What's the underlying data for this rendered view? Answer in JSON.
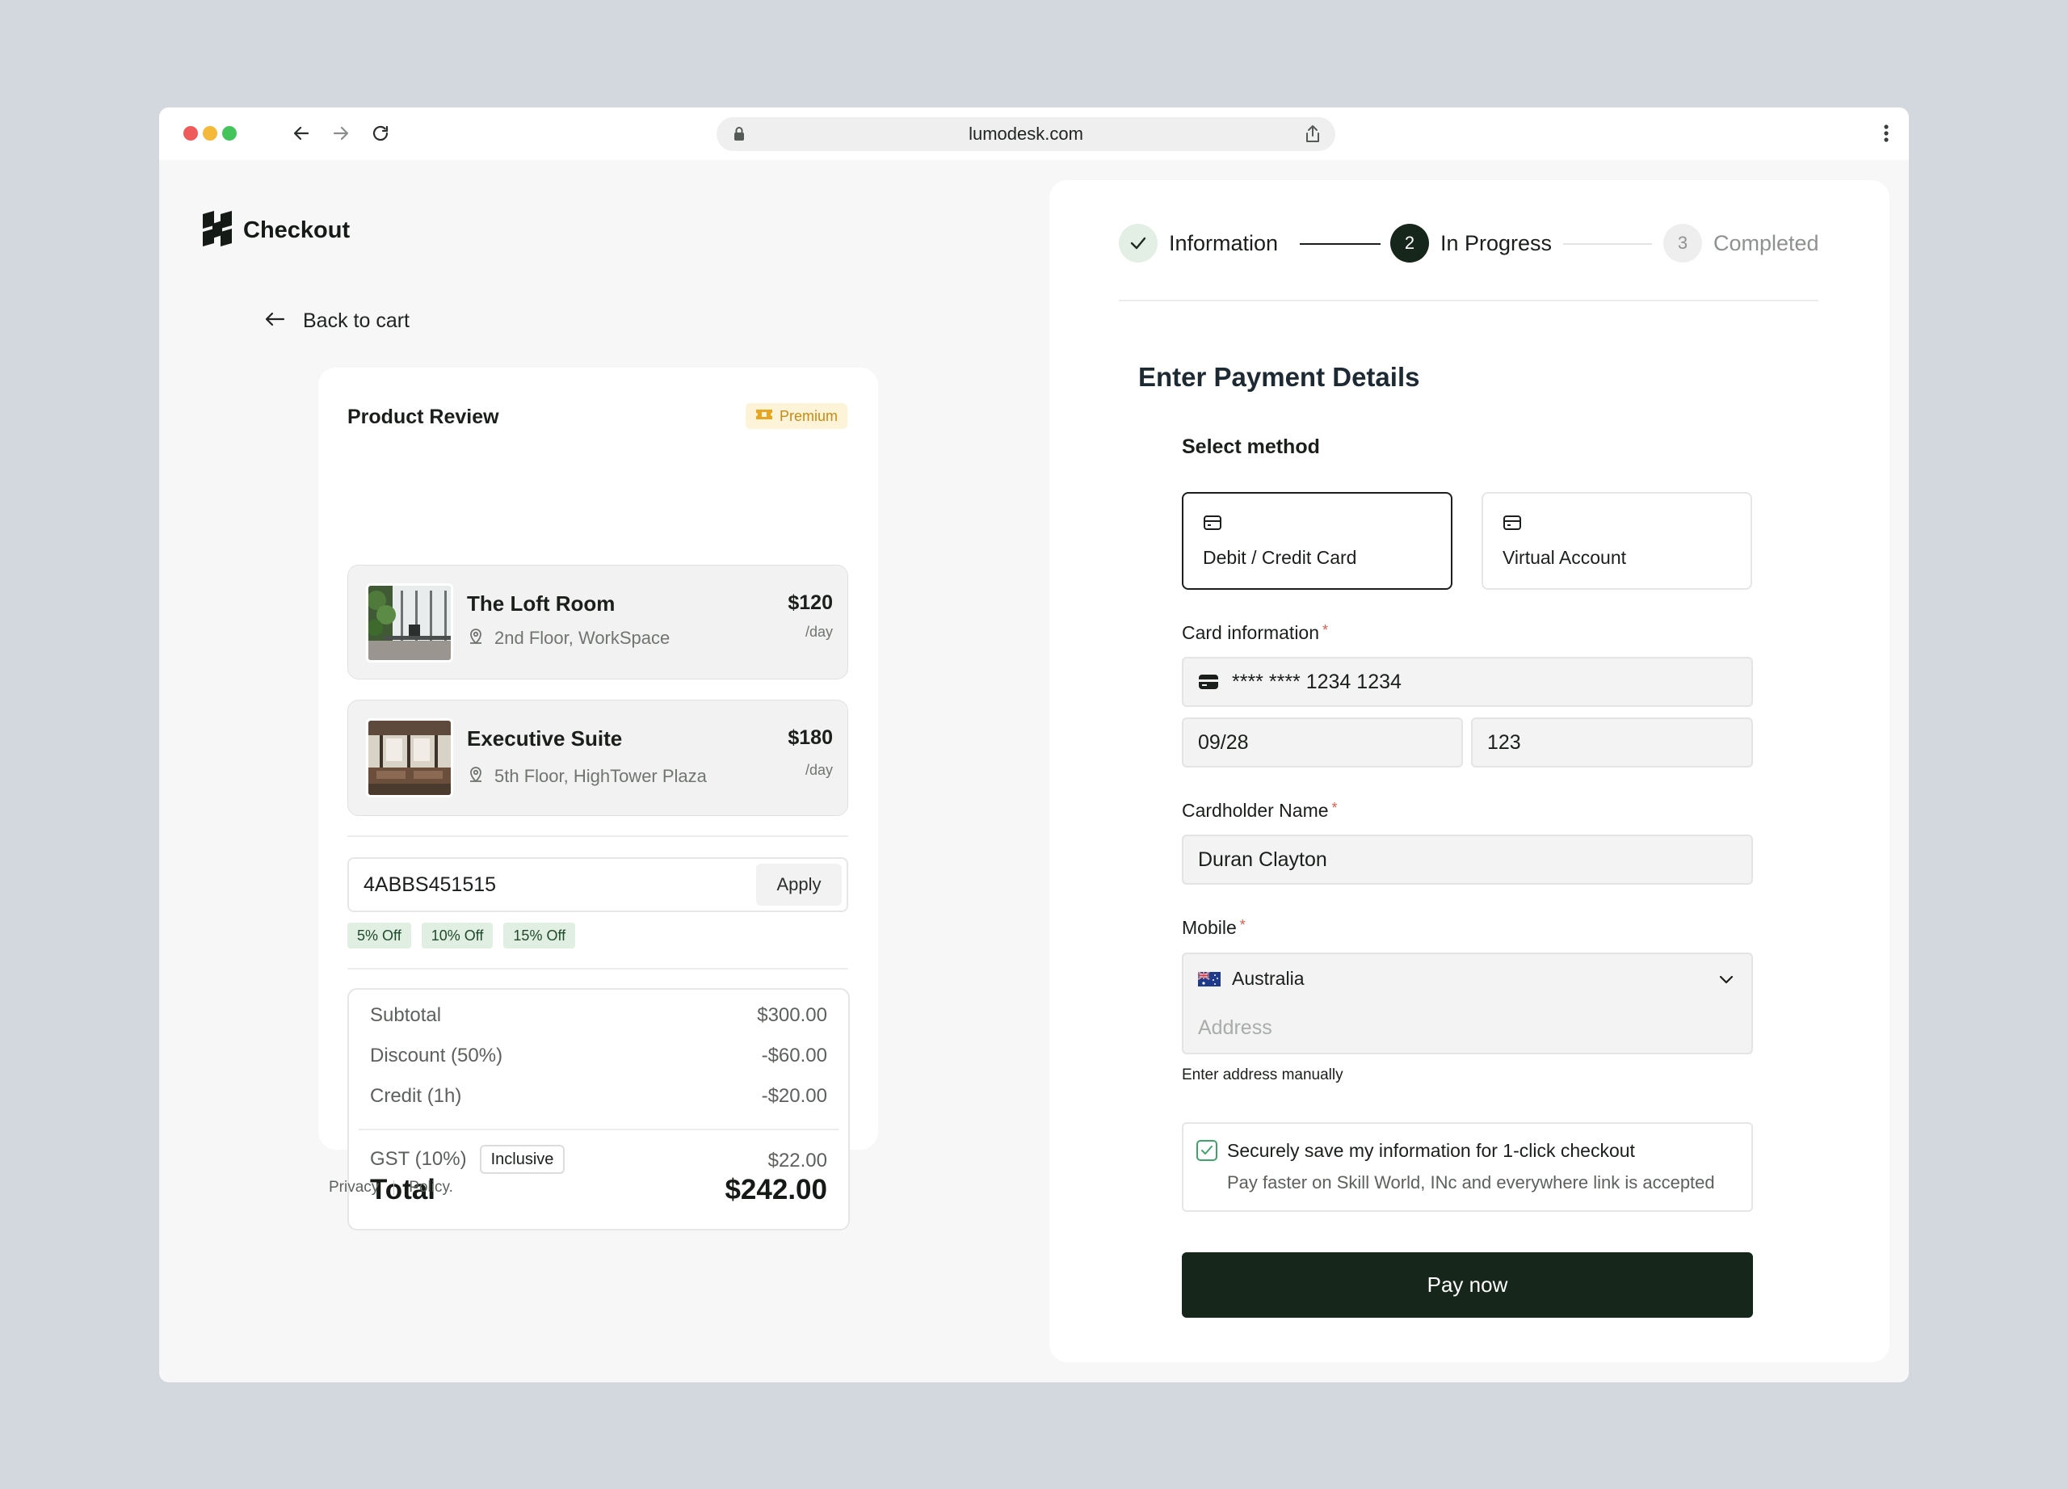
{
  "browser": {
    "url": "lumodesk.com",
    "dot_colors": [
      "#ef5b5b",
      "#f5b93a",
      "#46c45c"
    ]
  },
  "brand": {
    "name": "Checkout",
    "icon": "logo-mark-icon"
  },
  "back": {
    "label": "Back to cart",
    "icon": "arrow-left-icon"
  },
  "review": {
    "title": "Product Review",
    "badge": "Premium",
    "products": [
      {
        "name": "The Loft Room",
        "location": "2nd Floor, WorkSpace",
        "price": "$120",
        "unit": "/day"
      },
      {
        "name": "Executive Suite",
        "location": "5th Floor, HighTower Plaza",
        "price": "$180",
        "unit": "/day"
      }
    ],
    "coupon": {
      "value": "4ABBS451515",
      "apply_label": "Apply"
    },
    "discount_chips": [
      "5% Off",
      "10% Off",
      "15% Off"
    ],
    "summary": {
      "subtotal_label": "Subtotal",
      "subtotal_value": "$300.00",
      "discount_label": "Discount (50%)",
      "discount_value": "-$60.00",
      "credit_label": "Credit (1h)",
      "credit_value": "-$20.00",
      "gst_label": "GST (10%)",
      "gst_badge": "Inclusive",
      "gst_value": "$22.00",
      "total_label": "Total",
      "total_value": "$242.00"
    }
  },
  "footer": {
    "privacy": "Privacy",
    "policy": "Policy."
  },
  "steps": [
    {
      "number": "1",
      "label": "Information",
      "state": "done"
    },
    {
      "number": "2",
      "label": "In Progress",
      "state": "active"
    },
    {
      "number": "3",
      "label": "Completed",
      "state": "pending"
    }
  ],
  "payment": {
    "title": "Enter Payment Details",
    "select_method_label": "Select method",
    "methods": [
      {
        "label": "Debit / Credit Card",
        "selected": true
      },
      {
        "label": "Virtual Account",
        "selected": false
      }
    ],
    "card_label": "Card information",
    "card_number": "**** **** 1234 1234",
    "card_expiry": "09/28",
    "card_cvc": "123",
    "name_label": "Cardholder Name",
    "name_value": "Duran Clayton",
    "mobile_label": "Mobile",
    "country": "Australia",
    "address_placeholder": "Address",
    "manual_link": "Enter address manually",
    "save_title": "Securely save my information for 1-click checkout",
    "save_subtitle": "Pay faster on Skill World, INc and everywhere link is accepted",
    "pay_label": "Pay now"
  },
  "colors": {
    "accent_dark": "#16261a",
    "chip_bg": "#e1efe3",
    "premium": "#c88a12"
  }
}
